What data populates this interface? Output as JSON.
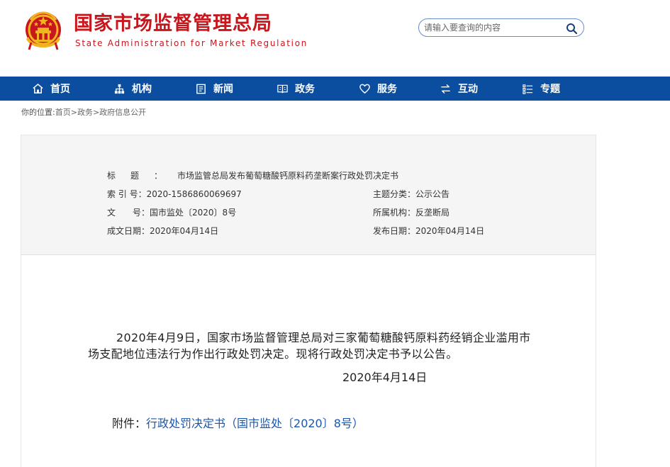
{
  "header": {
    "site_title": "国家市场监督管理总局",
    "site_subtitle": "State Administration for Market Regulation",
    "search": {
      "placeholder": "请输入要查询的内容",
      "value": ""
    }
  },
  "nav": {
    "items": [
      {
        "label": "首页",
        "icon": "home-icon"
      },
      {
        "label": "机构",
        "icon": "organization-icon"
      },
      {
        "label": "新闻",
        "icon": "news-icon"
      },
      {
        "label": "政务",
        "icon": "government-affairs-icon"
      },
      {
        "label": "服务",
        "icon": "service-heart-icon"
      },
      {
        "label": "互动",
        "icon": "interaction-arrows-icon"
      },
      {
        "label": "专题",
        "icon": "topics-list-icon"
      }
    ]
  },
  "breadcrumb": {
    "prefix": "你的位置:",
    "items": [
      "首页",
      "政务",
      "政府信息公开"
    ],
    "separator": ">"
  },
  "meta": {
    "title_label": "标题：",
    "title_value": "市场监管总局发布葡萄糖酸钙原料药垄断案行政处罚决定书",
    "index_label": "索 引 号：",
    "index_value": "2020-1586860069697",
    "topic_label": "主题分类：",
    "topic_value": "公示公告",
    "doc_no_label": "文　　号：",
    "doc_no_value": "国市监处〔2020〕8号",
    "agency_label": "所属机构：",
    "agency_value": "反垄断局",
    "created_label": "成文日期：",
    "created_value": "2020年04月14日",
    "published_label": "发布日期：",
    "published_value": "2020年04月14日"
  },
  "article": {
    "paragraph": "2020年4月9日，国家市场监督管理总局对三家葡萄糖酸钙原料药经销企业滥用市场支配地位违法行为作出行政处罚决定。现将行政处罚决定书予以公告。",
    "date": "2020年4月14日",
    "attachment_label": "附件：",
    "attachment_link": "行政处罚决定书（国市监处〔2020〕8号）"
  },
  "colors": {
    "brand_red": "#c8161d",
    "nav_blue": "#0b4d9e",
    "link_blue": "#1d57a8",
    "meta_background": "#f5f5f5"
  }
}
